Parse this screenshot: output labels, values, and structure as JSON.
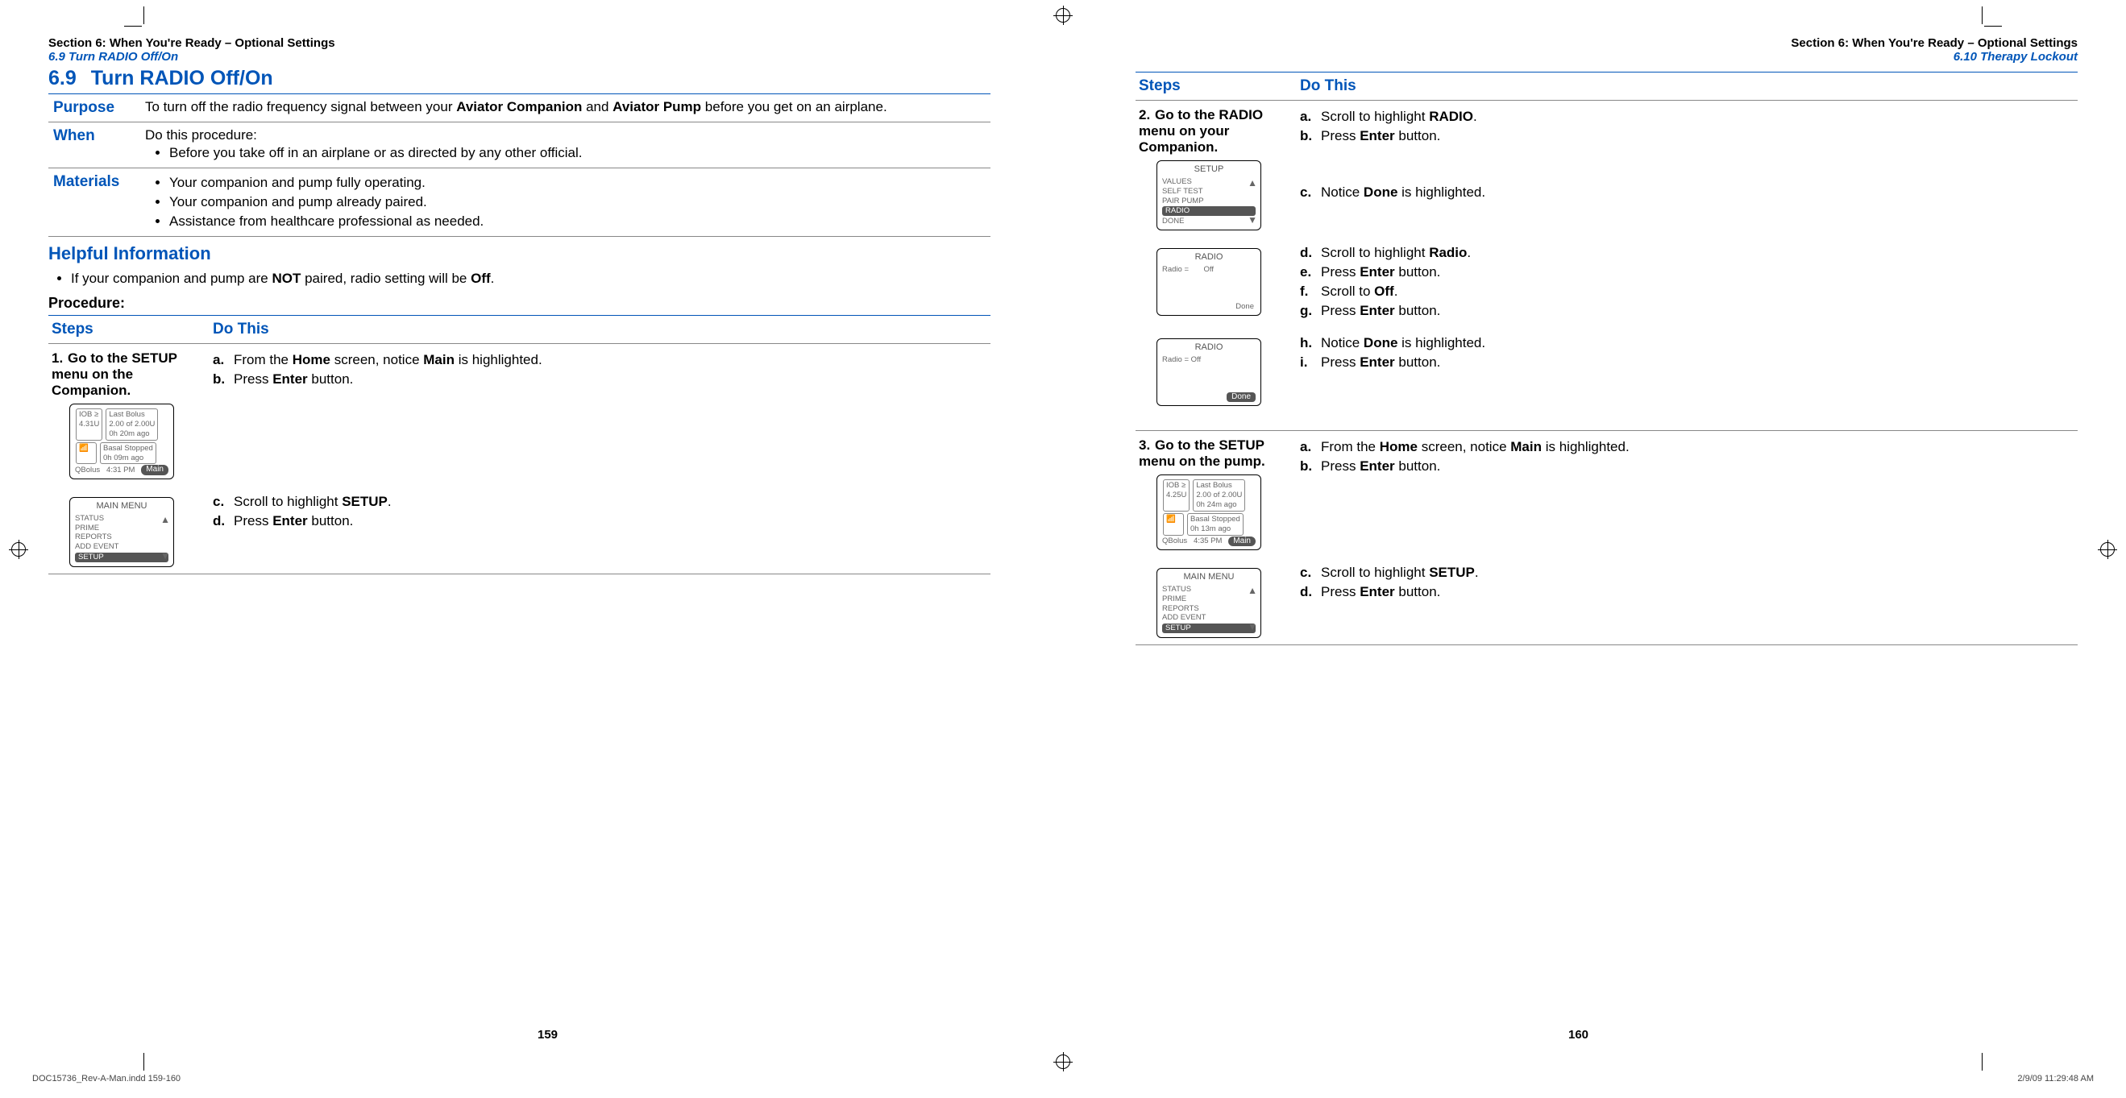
{
  "left": {
    "section_hdr": "Section 6: When You're Ready – Optional Settings",
    "section_sub": "6.9 Turn RADIO Off/On",
    "title_num": "6.9",
    "title_text": "Turn RADIO Off/On",
    "purpose_label": "Purpose",
    "purpose_pre": "To turn off the radio frequency signal between your ",
    "purpose_b1": "Aviator Companion",
    "purpose_mid": " and ",
    "purpose_b2": "Aviator Pump",
    "purpose_post": " before you get on an airplane.",
    "when_label": "When",
    "when_text": "Do this procedure:",
    "when_bullet": "Before you take off in an airplane or as directed by any other official.",
    "materials_label": "Materials",
    "materials": [
      "Your companion and pump fully operating.",
      "Your companion and pump already paired.",
      "Assistance from healthcare professional as needed."
    ],
    "helpful_title": "Helpful Information",
    "helpful_pre": "If your companion and pump are ",
    "helpful_b1": "NOT",
    "helpful_mid": " paired, radio setting will be ",
    "helpful_b2": "Off",
    "helpful_post": ".",
    "procedure": "Procedure:",
    "col_steps": "Steps",
    "col_do": "Do This",
    "step1_num": "1.",
    "step1_title_pre": "Go to the ",
    "step1_title_b": "SETUP menu",
    "step1_title_post": " on the Companion.",
    "s1a_l": "a.",
    "s1a_t1": "From the ",
    "s1a_b1": "Home",
    "s1a_t2": " screen, notice ",
    "s1a_b2": "Main",
    "s1a_t3": " is highlighted.",
    "s1b_l": "b.",
    "s1b_t1": "Press ",
    "s1b_b1": "Enter",
    "s1b_t2": " button.",
    "s1c_l": "c.",
    "s1c_t1": "Scroll to highlight ",
    "s1c_b1": "SETUP",
    "s1c_t2": ".",
    "s1d_l": "d.",
    "s1d_t1": "Press ",
    "s1d_b1": "Enter",
    "s1d_t2": " button.",
    "dev1": {
      "iob_label": "IOB ≥",
      "iob_val": "4.31U",
      "lb_title": "Last Bolus",
      "lb_line1": "2.00 of 2.00U",
      "lb_line2": "0h 20m ago",
      "basal": "Basal Stopped",
      "basal2": "0h 09m ago",
      "qb": "QBolus",
      "time": "4:31 PM",
      "main": "Main"
    },
    "dev2": {
      "title": "MAIN MENU",
      "items": [
        "STATUS",
        "PRIME",
        "REPORTS",
        "ADD EVENT"
      ],
      "hl": "SETUP"
    },
    "pagenum": "159"
  },
  "right": {
    "section_hdr": "Section 6: When You're Ready – Optional Settings",
    "section_sub": "6.10 Therapy Lockout",
    "col_steps": "Steps",
    "col_do": "Do This",
    "step2_num": "2.",
    "step2_title_pre": "Go to the ",
    "step2_title_b": "RADIO menu",
    "step2_title_post": " on your Companion.",
    "s2a_l": "a.",
    "s2a_t1": "Scroll to highlight ",
    "s2a_b": "RADIO",
    "s2a_t2": ".",
    "s2b_l": "b.",
    "s2b_t1": "Press ",
    "s2b_b": "Enter",
    "s2b_t2": " button.",
    "s2c_l": "c.",
    "s2c_t1": "Notice ",
    "s2c_b": "Done",
    "s2c_t2": " is highlighted.",
    "s2d_l": "d.",
    "s2d_t1": "Scroll to highlight ",
    "s2d_b": "Radio",
    "s2d_t2": ".",
    "s2e_l": "e.",
    "s2e_t1": "Press ",
    "s2e_b": "Enter",
    "s2e_t2": " button.",
    "s2f_l": "f.",
    "s2f_t1": "Scroll to ",
    "s2f_b": "Off",
    "s2f_t2": ".",
    "s2g_l": "g.",
    "s2g_t1": "Press ",
    "s2g_b": "Enter",
    "s2g_t2": " button.",
    "s2h_l": "h.",
    "s2h_t1": "Notice ",
    "s2h_b": "Done",
    "s2h_t2": " is highlighted.",
    "s2i_l": "i.",
    "s2i_t1": "Press ",
    "s2i_b": "Enter",
    "s2i_t2": " button.",
    "devA": {
      "title": "SETUP",
      "items": [
        "VALUES",
        "SELF TEST",
        "PAIR PUMP"
      ],
      "hl": "RADIO",
      "last": "DONE"
    },
    "devB": {
      "title": "RADIO",
      "line": "Radio =       Off",
      "done": "Done"
    },
    "devC": {
      "title": "RADIO",
      "line": "Radio = Off",
      "done": "Done"
    },
    "step3_num": "3.",
    "step3_title": "Go to the SETUP menu on the pump.",
    "s3a_l": "a.",
    "s3a_t1": "From the ",
    "s3a_b1": "Home",
    "s3a_t2": " screen, notice ",
    "s3a_b2": "Main",
    "s3a_t3": " is highlighted.",
    "s3b_l": "b.",
    "s3b_t1": "Press ",
    "s3b_b": "Enter",
    "s3b_t2": " button.",
    "s3c_l": "c.",
    "s3c_t1": "Scroll to highlight ",
    "s3c_b": "SETUP",
    "s3c_t2": ".",
    "s3d_l": "d.",
    "s3d_t1": "Press ",
    "s3d_b": "Enter",
    "s3d_t2": " button.",
    "devD": {
      "iob_label": "IOB ≥",
      "iob_val": "4.25U",
      "lb_title": "Last Bolus",
      "lb_line1": "2.00 of 2.00U",
      "lb_line2": "0h 24m ago",
      "basal": "Basal Stopped",
      "basal2": "0h 13m ago",
      "qb": "QBolus",
      "time": "4:35 PM",
      "main": "Main"
    },
    "devE": {
      "title": "MAIN MENU",
      "items": [
        "STATUS",
        "PRIME",
        "REPORTS",
        "ADD EVENT"
      ],
      "hl": "SETUP"
    },
    "pagenum": "160"
  },
  "imprint_left": "DOC15736_Rev-A-Man.indd   159-160",
  "imprint_right": "2/9/09   11:29:48 AM"
}
